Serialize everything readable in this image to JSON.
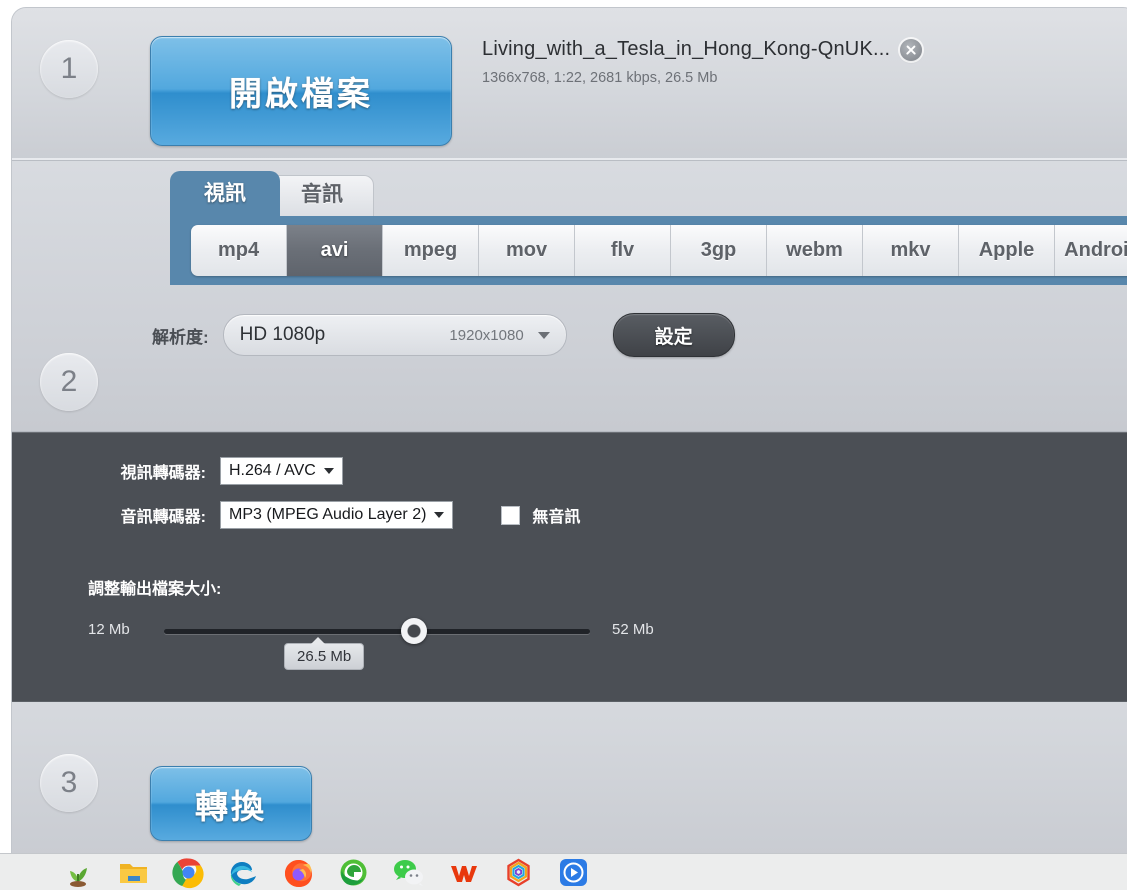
{
  "window": {
    "steps": {
      "one": "1",
      "two": "2",
      "three": "3"
    }
  },
  "step1": {
    "open_button_label": "開啟檔案",
    "file_name": "Living_with_a_Tesla_in_Hong_Kong-QnUK...",
    "file_meta": "1366x768, 1:22, 2681 kbps, 26.5 Mb",
    "close_icon": "close-circle-icon"
  },
  "step2": {
    "tabs": [
      {
        "label": "視訊",
        "active": true
      },
      {
        "label": "音訊",
        "active": false
      }
    ],
    "formats": [
      {
        "label": "mp4",
        "selected": false
      },
      {
        "label": "avi",
        "selected": true
      },
      {
        "label": "mpeg",
        "selected": false
      },
      {
        "label": "mov",
        "selected": false
      },
      {
        "label": "flv",
        "selected": false
      },
      {
        "label": "3gp",
        "selected": false
      },
      {
        "label": "webm",
        "selected": false
      },
      {
        "label": "mkv",
        "selected": false
      },
      {
        "label": "Apple",
        "selected": false
      },
      {
        "label": "Android",
        "selected": false
      }
    ],
    "resolution": {
      "label": "解析度:",
      "value": "HD 1080p",
      "dimensions": "1920x1080",
      "caret_icon": "chevron-down-icon"
    },
    "settings_button_label": "設定"
  },
  "settings_panel": {
    "video_codec": {
      "label": "視訊轉碼器:",
      "value": "H.264 / AVC"
    },
    "audio_codec": {
      "label": "音訊轉碼器:",
      "value": "MP3 (MPEG Audio Layer 2)"
    },
    "no_audio": {
      "label": "無音訊",
      "checked": false
    },
    "size_slider": {
      "title": "調整輸出檔案大小:",
      "min_label": "12 Mb",
      "max_label": "52 Mb",
      "current_label": "26.5 Mb",
      "min": 12,
      "max": 52,
      "value": 26.5
    }
  },
  "step3": {
    "convert_button_label": "轉換"
  },
  "taskbar": {
    "items": [
      {
        "name": "sprout-icon",
        "pinned": true
      },
      {
        "name": "file-explorer-icon",
        "pinned": false
      },
      {
        "name": "chrome-icon",
        "pinned": true
      },
      {
        "name": "edge-icon",
        "pinned": false
      },
      {
        "name": "firefox-icon",
        "pinned": false
      },
      {
        "name": "internet-explorer-icon",
        "pinned": false
      },
      {
        "name": "wechat-icon",
        "pinned": false
      },
      {
        "name": "wps-office-icon",
        "pinned": false
      },
      {
        "name": "hexagon-app-icon",
        "pinned": true
      },
      {
        "name": "media-player-icon",
        "pinned": false
      }
    ]
  },
  "colors": {
    "accent_blue": "#2f8ecd",
    "tab_blue": "#5887ac",
    "dark_panel": "#4b4f55",
    "selected_format": "#6a6f77"
  }
}
